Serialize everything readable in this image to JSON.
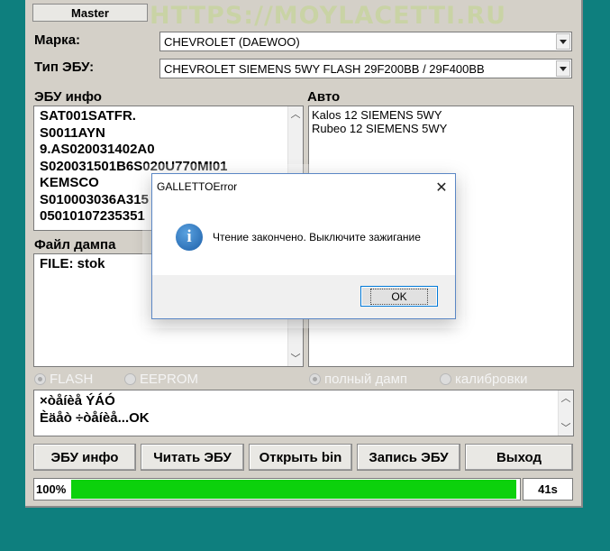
{
  "toolbar": {
    "master_label": "Master"
  },
  "watermark": "HTTPS://MOYLACETTI.RU",
  "form": {
    "marka_label": "Марка:",
    "marka_value": "CHEVROLET (DAEWOO)",
    "ecu_type_label": "Тип ЭБУ:",
    "ecu_type_value": "CHEVROLET SIEMENS 5WY FLASH 29F200BB / 29F400BB"
  },
  "ecu_info": {
    "label": "ЭБУ инфо",
    "lines": [
      "SAT001SATFR.",
      "S0011AYN",
      "9.AS020031402A0",
      "S020031501B6S020U770MI01",
      "KEMSCO",
      "S010003036A315",
      "05010107235351"
    ]
  },
  "auto": {
    "label": "Авто",
    "lines": [
      "Kalos 12 SIEMENS 5WY",
      "Rubeo 12 SIEMENS 5WY"
    ]
  },
  "dump": {
    "label": "Файл дампа",
    "lines": [
      "FILE: stok"
    ]
  },
  "radios": {
    "flash": "FLASH",
    "eeprom": "EEPROM",
    "full_dump": "полный дамп",
    "calibrations": "калибровки"
  },
  "log": {
    "lines": [
      "×òåíèå ÝÁÓ",
      "Èäåò ÷òåíèå...OK"
    ]
  },
  "buttons": {
    "ecu_info": "ЭБУ инфо",
    "read_ecu": "Читать ЭБУ",
    "open_bin": "Открыть bin",
    "write_ecu": "Запись ЭБУ",
    "exit": "Выход"
  },
  "progress": {
    "percent_label": "100%",
    "value": 1.0
  },
  "timer": "41s",
  "dialog": {
    "title": "GALLETTOError",
    "message": "Чтение закончено. Выключите зажигание",
    "ok_label": "OK"
  },
  "colors": {
    "background": "#0e7f7e",
    "progress_fill": "#0cd10c",
    "window": "#d4d0c8"
  }
}
